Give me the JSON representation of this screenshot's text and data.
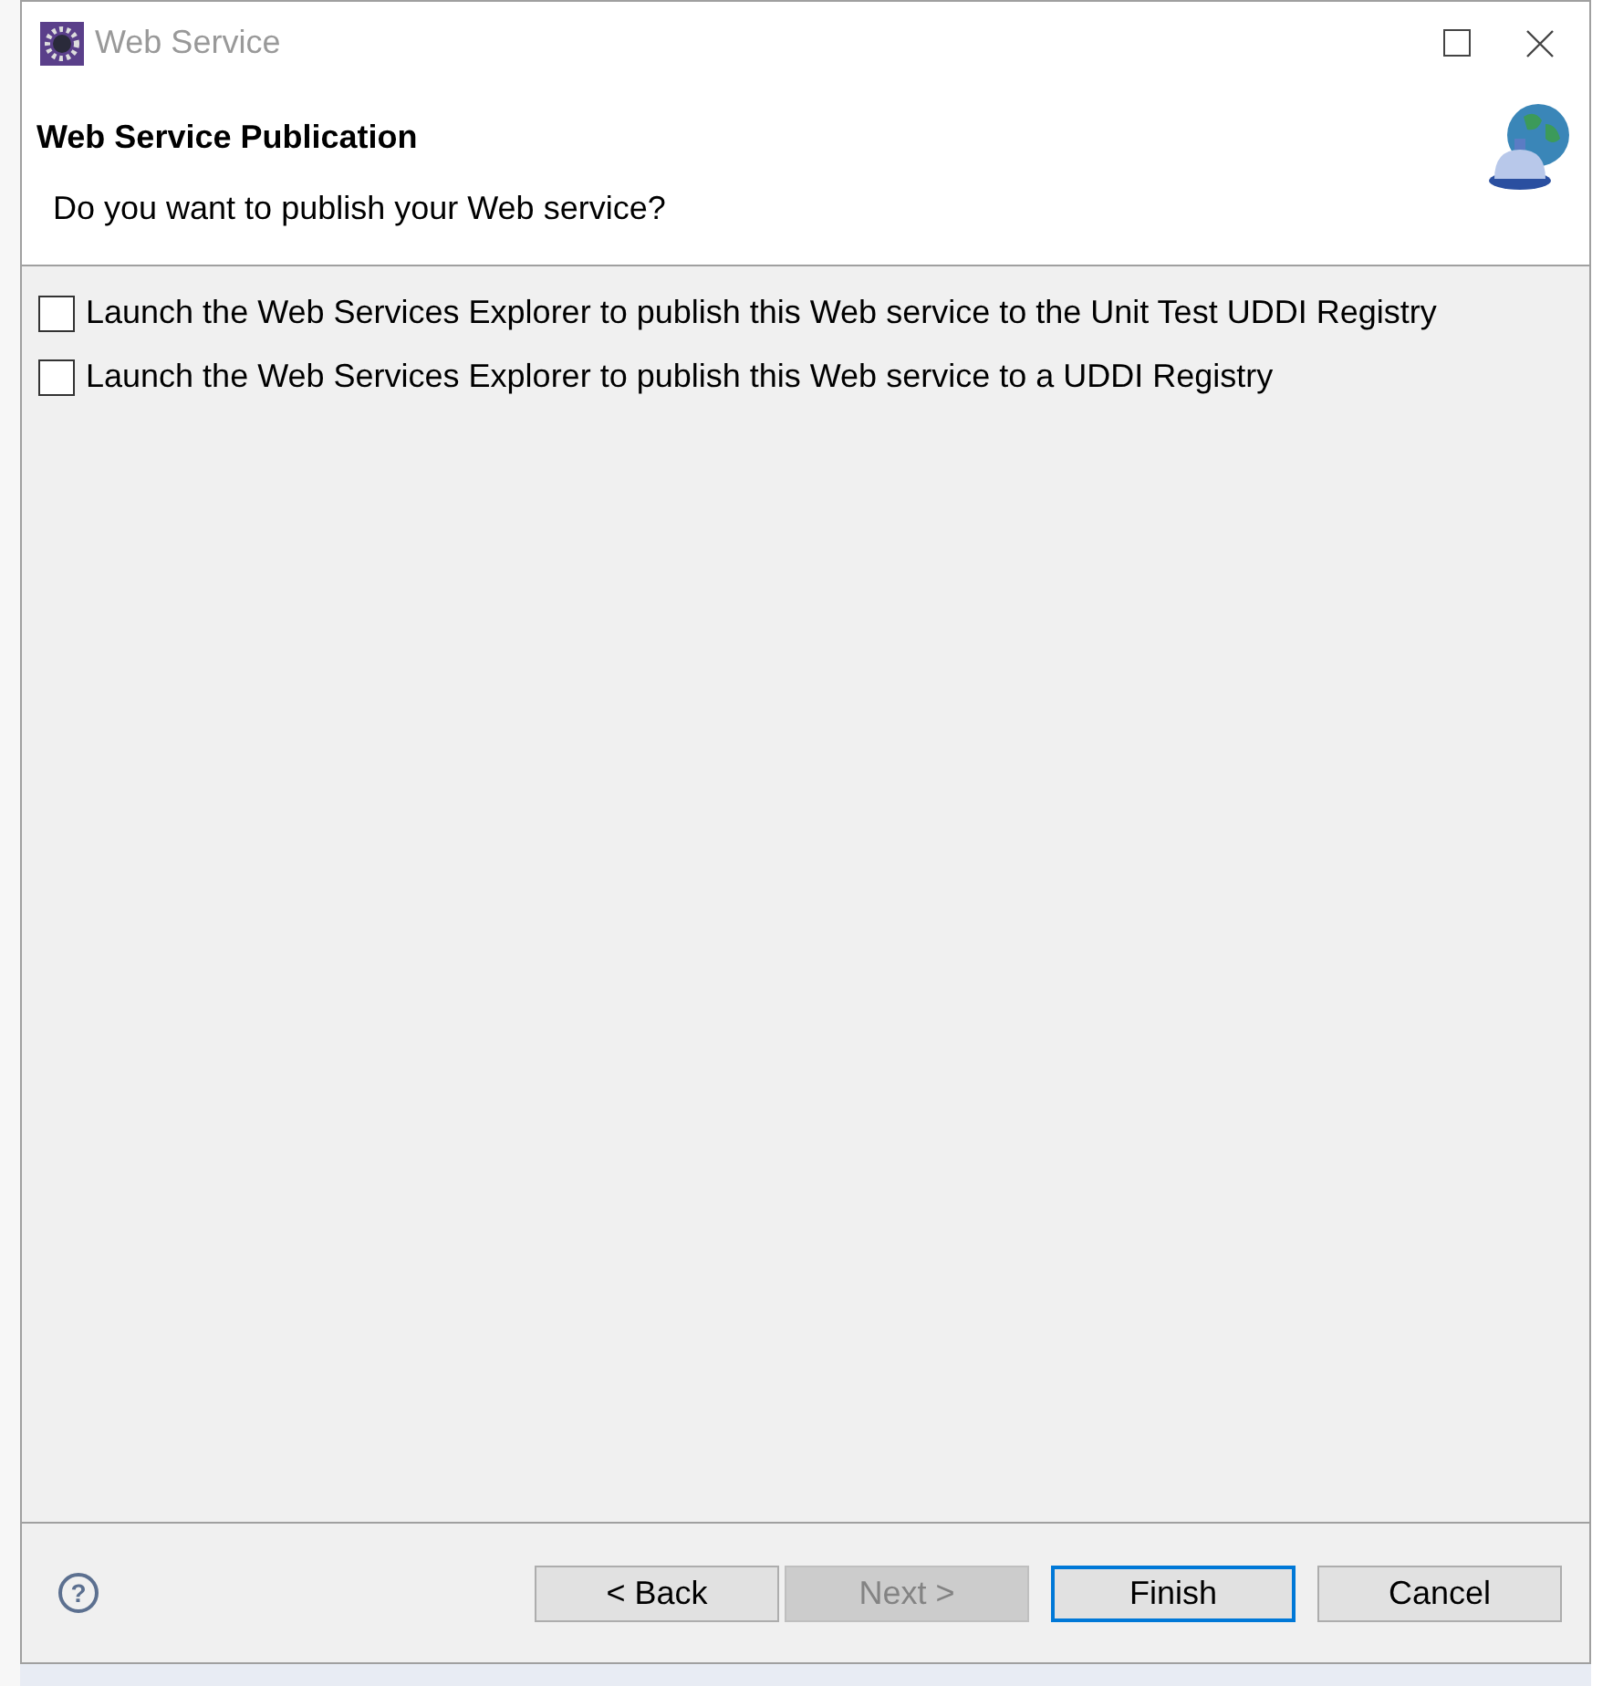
{
  "window": {
    "title": "Web Service"
  },
  "header": {
    "title": "Web Service Publication",
    "description": "Do you want to publish your Web service?"
  },
  "options": [
    {
      "label": "Launch the Web Services Explorer to publish this Web service to the Unit Test UDDI Registry",
      "checked": false
    },
    {
      "label": "Launch the Web Services Explorer to publish this Web service to a UDDI Registry",
      "checked": false
    }
  ],
  "help": {
    "label": "?"
  },
  "buttons": [
    {
      "label": "< Back",
      "disabled": false,
      "default": false
    },
    {
      "label": "Next >",
      "disabled": true,
      "default": false
    },
    {
      "label": "Finish",
      "disabled": false,
      "default": true
    },
    {
      "label": "Cancel",
      "disabled": false,
      "default": false
    }
  ]
}
